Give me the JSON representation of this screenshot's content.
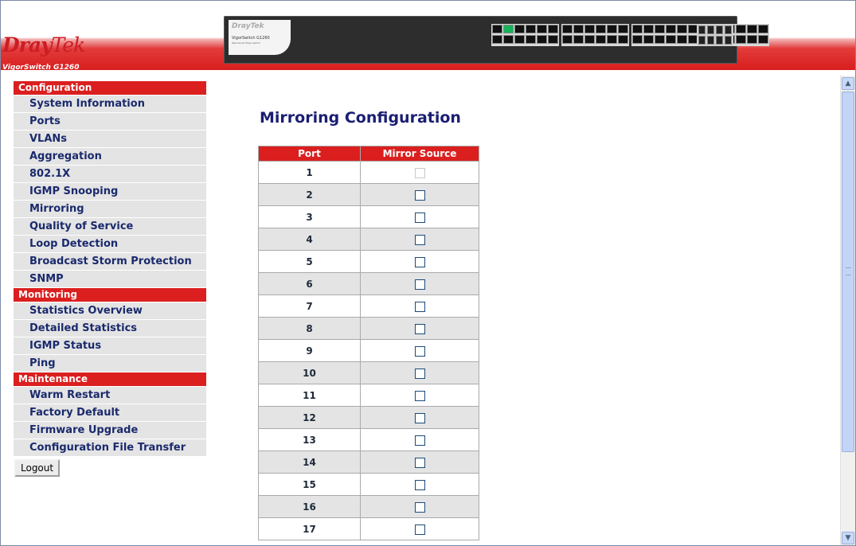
{
  "header": {
    "logo_primary": "Dray",
    "logo_secondary": "Tek",
    "model": "VigorSwitch G1260",
    "device_brand": "DrayTek",
    "device_model": "VigorSwitch G1260",
    "device_subtitle": "Web Smart Edge Switch",
    "colors": {
      "brand_red": "#db1f1f",
      "nav_text": "#1a2a6c",
      "title": "#1a1e72"
    }
  },
  "sidebar": {
    "configuration": {
      "label": "Configuration",
      "items": [
        "System Information",
        "Ports",
        "VLANs",
        "Aggregation",
        "802.1X",
        "IGMP Snooping",
        "Mirroring",
        "Quality of Service",
        "Loop Detection",
        "Broadcast Storm Protection",
        "SNMP"
      ]
    },
    "monitoring": {
      "label": "Monitoring",
      "items": [
        "Statistics Overview",
        "Detailed Statistics",
        "IGMP Status",
        "Ping"
      ]
    },
    "maintenance": {
      "label": "Maintenance",
      "items": [
        "Warm Restart",
        "Factory Default",
        "Firmware Upgrade",
        "Configuration File Transfer"
      ]
    },
    "logout_label": "Logout"
  },
  "main": {
    "title": "Mirroring Configuration",
    "columns": [
      "Port",
      "Mirror Source"
    ],
    "rows": [
      {
        "port": "1",
        "checked": false,
        "disabled": true
      },
      {
        "port": "2",
        "checked": false,
        "disabled": false
      },
      {
        "port": "3",
        "checked": false,
        "disabled": false
      },
      {
        "port": "4",
        "checked": false,
        "disabled": false
      },
      {
        "port": "5",
        "checked": false,
        "disabled": false
      },
      {
        "port": "6",
        "checked": false,
        "disabled": false
      },
      {
        "port": "7",
        "checked": false,
        "disabled": false
      },
      {
        "port": "8",
        "checked": false,
        "disabled": false
      },
      {
        "port": "9",
        "checked": false,
        "disabled": false
      },
      {
        "port": "10",
        "checked": false,
        "disabled": false
      },
      {
        "port": "11",
        "checked": false,
        "disabled": false
      },
      {
        "port": "12",
        "checked": false,
        "disabled": false
      },
      {
        "port": "13",
        "checked": false,
        "disabled": false
      },
      {
        "port": "14",
        "checked": false,
        "disabled": false
      },
      {
        "port": "15",
        "checked": false,
        "disabled": false
      },
      {
        "port": "16",
        "checked": false,
        "disabled": false
      },
      {
        "port": "17",
        "checked": false,
        "disabled": false
      }
    ]
  },
  "icons": {
    "scroll_up": "chevron-up-icon",
    "scroll_down": "chevron-down-icon"
  }
}
